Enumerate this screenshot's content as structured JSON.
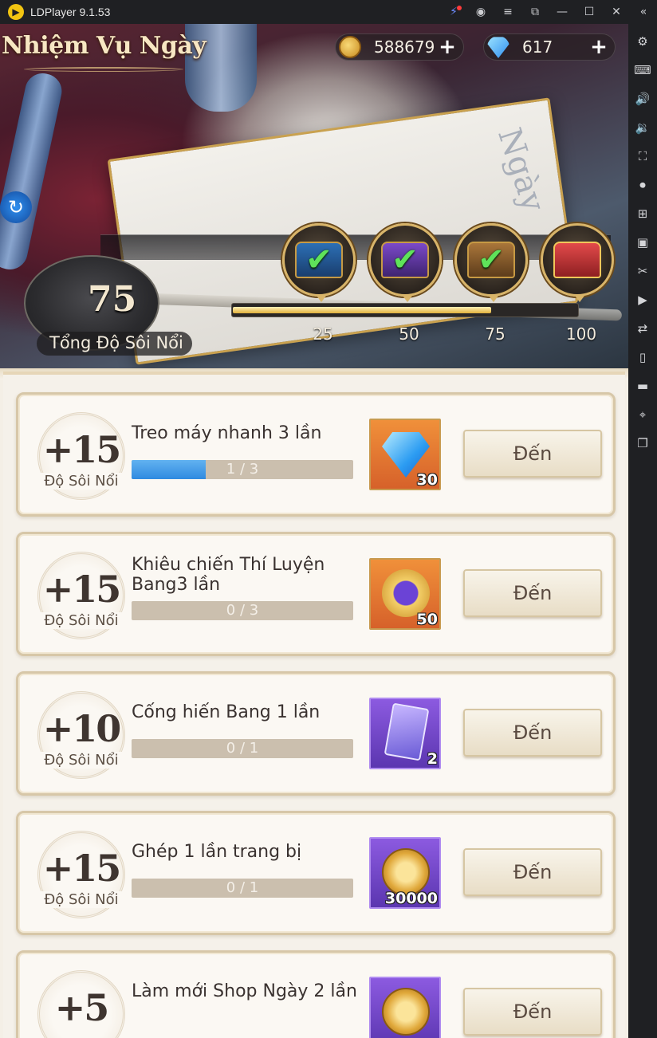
{
  "window": {
    "title": "LDPlayer 9.1.53"
  },
  "header": {
    "page_title": "Nhiệm Vụ Ngày",
    "paper_word": "Ngày",
    "coins": "588679",
    "gems": "617",
    "total_activity": "75",
    "total_activity_label": "Tổng Độ Sôi Nổi",
    "progress": {
      "current": 75,
      "max": 100
    },
    "milestones": [
      {
        "label": "25",
        "chest": "blue",
        "claimed": true
      },
      {
        "label": "50",
        "chest": "purple",
        "claimed": true
      },
      {
        "label": "75",
        "chest": "brown",
        "claimed": true
      },
      {
        "label": "100",
        "chest": "red",
        "claimed": false
      }
    ]
  },
  "tasks": [
    {
      "points": "+15",
      "unit": "Độ Sôi Nổi",
      "name": "Treo máy nhanh 3 lần",
      "progress_text": "1 / 3",
      "progress": 0.333,
      "reward_icon": "diamond-icon",
      "reward_qty": "30",
      "reward_bg": "orange",
      "button": "Đến"
    },
    {
      "points": "+15",
      "unit": "Độ Sôi Nổi",
      "name": "Khiêu chiến Thí Luyện Bang3 lần",
      "progress_text": "0 / 3",
      "progress": 0,
      "reward_icon": "medal-icon",
      "reward_qty": "50",
      "reward_bg": "orange",
      "button": "Đến"
    },
    {
      "points": "+10",
      "unit": "Độ Sôi Nổi",
      "name": "Cống hiến Bang 1 lần",
      "progress_text": "0 / 1",
      "progress": 0,
      "reward_icon": "card-icon",
      "reward_qty": "2",
      "reward_bg": "purple",
      "button": "Đến"
    },
    {
      "points": "+15",
      "unit": "Độ Sôi Nổi",
      "name": "Ghép 1 lần trang bị",
      "progress_text": "0 / 1",
      "progress": 0,
      "reward_icon": "coin-icon",
      "reward_qty": "30000",
      "reward_bg": "purple",
      "button": "Đến"
    },
    {
      "points": "+5",
      "unit": "",
      "name": "Làm mới Shop Ngày 2 lần",
      "progress_text": "",
      "progress": 0,
      "reward_icon": "coin-icon",
      "reward_qty": "",
      "reward_bg": "purple",
      "button": "Đến"
    }
  ],
  "colors": {
    "accent_blue": "#2f8ae0",
    "gold": "#e1b13b",
    "text_dark": "#3a3230"
  }
}
